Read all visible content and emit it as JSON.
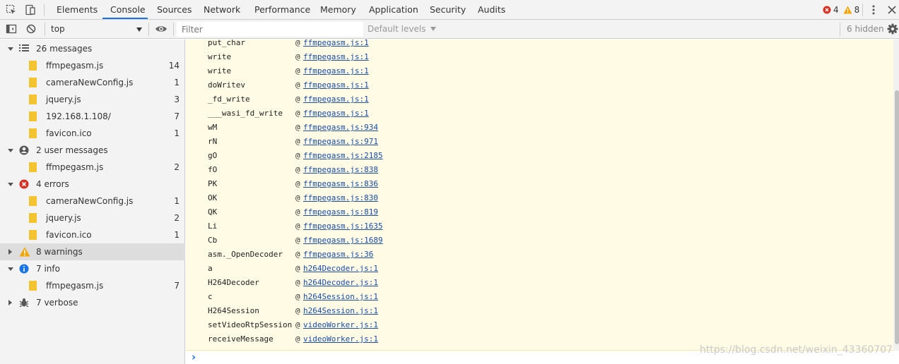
{
  "tabs": [
    "Elements",
    "Console",
    "Sources",
    "Network",
    "Performance",
    "Memory",
    "Application",
    "Security",
    "Audits"
  ],
  "active_tab": "Console",
  "header_counts": {
    "errors": "4",
    "warnings": "8"
  },
  "toolbar": {
    "context": "top",
    "filter_placeholder": "Filter",
    "levels": "Default levels",
    "hidden": "6 hidden"
  },
  "sidebar": {
    "groups": [
      {
        "label": "26 messages",
        "icon": "list-icon",
        "files": [
          {
            "name": "ffmpegasm.js",
            "count": "14"
          },
          {
            "name": "cameraNewConfig.js",
            "count": "1"
          },
          {
            "name": "jquery.js",
            "count": "3"
          },
          {
            "name": "192.168.1.108/",
            "count": "7"
          },
          {
            "name": "favicon.ico",
            "count": "1"
          }
        ]
      },
      {
        "label": "2 user messages",
        "icon": "user-icon",
        "files": [
          {
            "name": "ffmpegasm.js",
            "count": "2"
          }
        ]
      },
      {
        "label": "4 errors",
        "icon": "error-icon",
        "files": [
          {
            "name": "cameraNewConfig.js",
            "count": "1"
          },
          {
            "name": "jquery.js",
            "count": "2"
          },
          {
            "name": "favicon.ico",
            "count": "1"
          }
        ]
      },
      {
        "label": "8 warnings",
        "icon": "warning-icon",
        "files": []
      },
      {
        "label": "7 info",
        "icon": "info-icon",
        "files": [
          {
            "name": "ffmpegasm.js",
            "count": "7"
          }
        ]
      },
      {
        "label": "7 verbose",
        "icon": "bug-icon",
        "files": []
      }
    ]
  },
  "trace": [
    {
      "fn": "put_char",
      "loc": "ffmpegasm.js:1"
    },
    {
      "fn": "write",
      "loc": "ffmpegasm.js:1"
    },
    {
      "fn": "write",
      "loc": "ffmpegasm.js:1"
    },
    {
      "fn": "doWritev",
      "loc": "ffmpegasm.js:1"
    },
    {
      "fn": "_fd_write",
      "loc": "ffmpegasm.js:1"
    },
    {
      "fn": "___wasi_fd_write",
      "loc": "ffmpegasm.js:1"
    },
    {
      "fn": "wM",
      "loc": "ffmpegasm.js:934"
    },
    {
      "fn": "rN",
      "loc": "ffmpegasm.js:971"
    },
    {
      "fn": "gO",
      "loc": "ffmpegasm.js:2185"
    },
    {
      "fn": "fO",
      "loc": "ffmpegasm.js:838"
    },
    {
      "fn": "PK",
      "loc": "ffmpegasm.js:836"
    },
    {
      "fn": "OK",
      "loc": "ffmpegasm.js:830"
    },
    {
      "fn": "QK",
      "loc": "ffmpegasm.js:819"
    },
    {
      "fn": "Li",
      "loc": "ffmpegasm.js:1635"
    },
    {
      "fn": "Cb",
      "loc": "ffmpegasm.js:1689"
    },
    {
      "fn": "asm._OpenDecoder",
      "loc": "ffmpegasm.js:36"
    },
    {
      "fn": "a",
      "loc": "h264Decoder.js:1"
    },
    {
      "fn": "H264Decoder",
      "loc": "h264Decoder.js:1"
    },
    {
      "fn": "c",
      "loc": "h264Session.js:1"
    },
    {
      "fn": "H264Session",
      "loc": "h264Session.js:1"
    },
    {
      "fn": "setVideoRtpSession",
      "loc": "videoWorker.js:1"
    },
    {
      "fn": "receiveMessage",
      "loc": "videoWorker.js:1"
    }
  ],
  "at_symbol": "@",
  "prompt_symbol": "›",
  "watermark": "https://blog.csdn.net/weixin_43360707"
}
